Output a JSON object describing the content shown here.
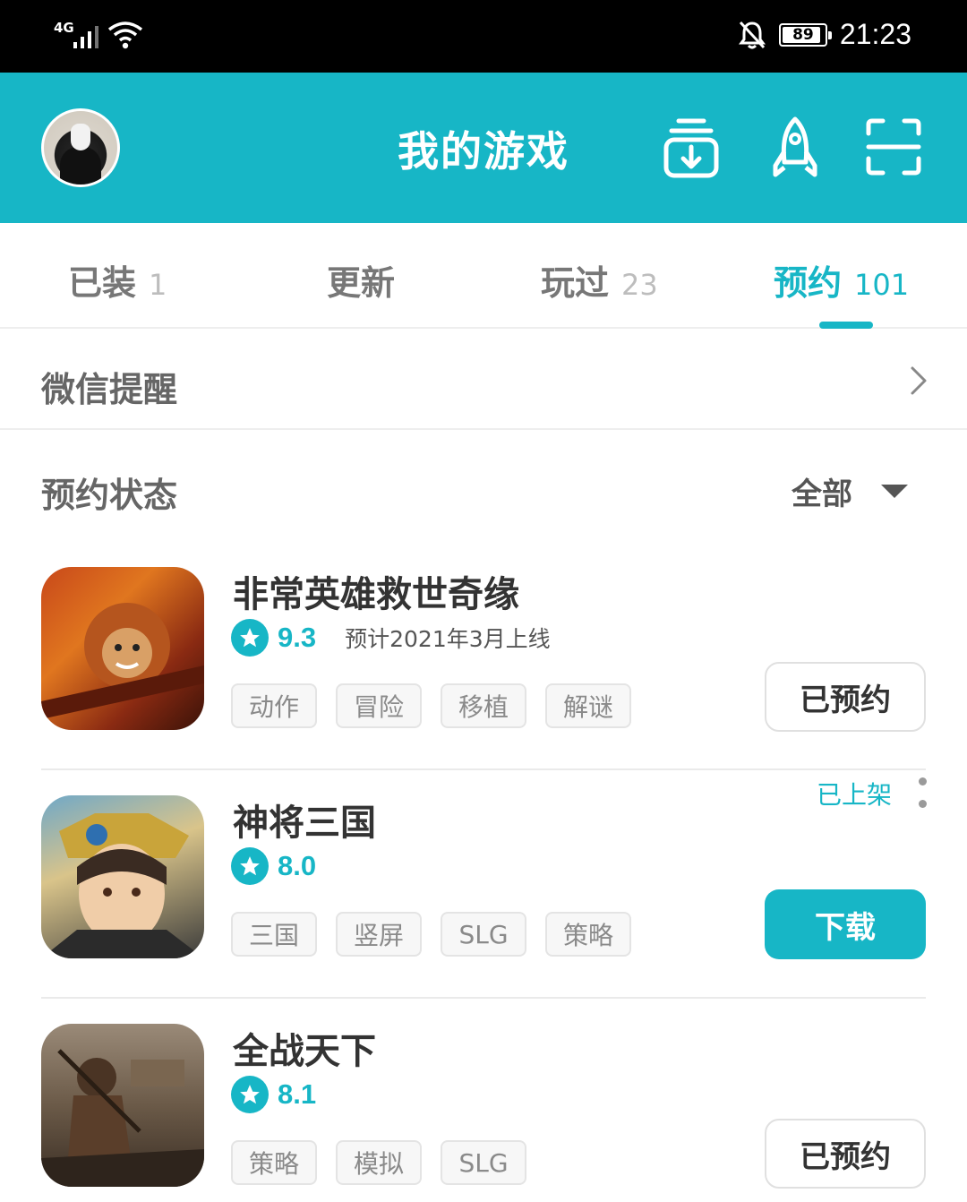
{
  "status_bar": {
    "network": "4G",
    "battery": "89",
    "time": "21:23",
    "icons": [
      "signal-icon",
      "wifi-icon",
      "bell-off-icon",
      "battery-icon"
    ]
  },
  "header": {
    "title": "我的游戏",
    "background": "#17b6c6",
    "actions": [
      "download-manager-icon",
      "rocket-icon",
      "scan-icon"
    ]
  },
  "tabs": [
    {
      "label": "已装",
      "count": "1"
    },
    {
      "label": "更新",
      "count": ""
    },
    {
      "label": "玩过",
      "count": "23"
    },
    {
      "label": "预约",
      "count": "101",
      "active": true
    }
  ],
  "wechat_reminder": {
    "label": "微信提醒"
  },
  "reservation_status": {
    "label": "预约状态",
    "filter": "全部"
  },
  "games": [
    {
      "name": "非常英雄救世奇缘",
      "score": "9.3",
      "release": "预计2021年3月上线",
      "tags": [
        "动作",
        "冒险",
        "移植",
        "解谜"
      ],
      "button": "已预约"
    },
    {
      "name": "神将三国",
      "score": "8.0",
      "shelf_status": "已上架",
      "tags": [
        "三国",
        "竖屏",
        "SLG",
        "策略"
      ],
      "button": "下载"
    },
    {
      "name": "全战天下",
      "score": "8.1",
      "tags": [
        "策略",
        "模拟",
        "SLG"
      ],
      "button": "已预约"
    }
  ],
  "colors": {
    "accent": "#17b6c6",
    "text": "#333333",
    "muted": "#8a8a8a"
  }
}
